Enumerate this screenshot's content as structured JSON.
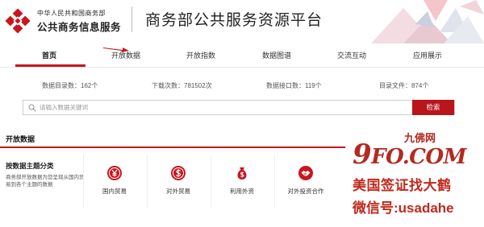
{
  "header": {
    "org_small": "中华人民共和国商务部",
    "org_big": "公共商务信息服务",
    "platform_title": "商务部公共服务资源平台"
  },
  "nav": {
    "items": [
      "首页",
      "开放数据",
      "开放指数",
      "数据图谱",
      "交流互动",
      "应用展示"
    ],
    "active_index": 0
  },
  "stats": {
    "catalog_count": "数据目录数：162个",
    "download_count": "下载次数：781502次",
    "api_count": "数据接口数：119个",
    "file_count": "目录文件：874个"
  },
  "search": {
    "placeholder": "请输入数据关键词",
    "button_label": "检索"
  },
  "open_data": {
    "section_title": "开放数据",
    "category_title": "按数据主题分类",
    "category_desc": "商务部开放数据为您呈现从国内贸易到各个主题的数据",
    "categories": [
      {
        "label": "国内贸易",
        "icon": "yen-coin-icon"
      },
      {
        "label": "对外贸易",
        "icon": "dollar-coin-icon"
      },
      {
        "label": "利用外资",
        "icon": "money-bag-icon"
      },
      {
        "label": "对外投资合作",
        "icon": "handshake-icon"
      }
    ]
  },
  "watermark": {
    "site_cn": "九佛网",
    "site_domain_9": "9",
    "site_domain_rest": "FO.COM",
    "line1": "美国签证找大鹤",
    "line2": "微信号:usadahe"
  },
  "colors": {
    "brand_red": "#c7161d",
    "button_red": "#b8161b",
    "watermark_red": "#b22a20"
  }
}
